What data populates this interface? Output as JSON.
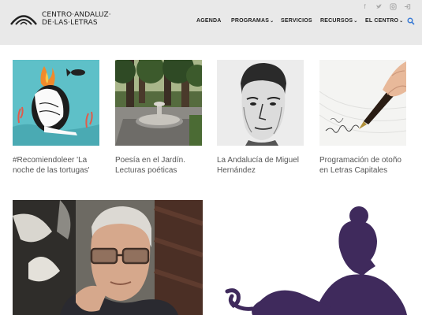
{
  "header": {
    "logo_line1": "CENTRO·ANDALUZ·",
    "logo_line2": "DE·LAS·LETRAS",
    "social_icons": [
      "facebook-icon",
      "twitter-icon",
      "instagram-icon",
      "login-icon"
    ],
    "nav": [
      {
        "label": "AGENDA",
        "dropdown": false
      },
      {
        "label": "PROGRAMAS",
        "dropdown": true
      },
      {
        "label": "SERVICIOS",
        "dropdown": false
      },
      {
        "label": "RECURSOS",
        "dropdown": true
      },
      {
        "label": "EL CENTRO",
        "dropdown": true
      }
    ],
    "chevron": "⌄",
    "search_icon": "search-icon"
  },
  "cards": [
    {
      "title": "#Recomiendoleer 'La noche de las tortugas'"
    },
    {
      "title": "Poesía en el Jardín. Lecturas poéticas"
    },
    {
      "title": "La Andalucía de Miguel Hernández"
    },
    {
      "title": "Programación de otoño en Letras Capitales"
    }
  ],
  "colors": {
    "header_bg": "#e9e9e9",
    "accent_blue": "#3a7bd5",
    "silhouette_purple": "#3f2a5c",
    "card1_bg": "#5ec0c8"
  }
}
